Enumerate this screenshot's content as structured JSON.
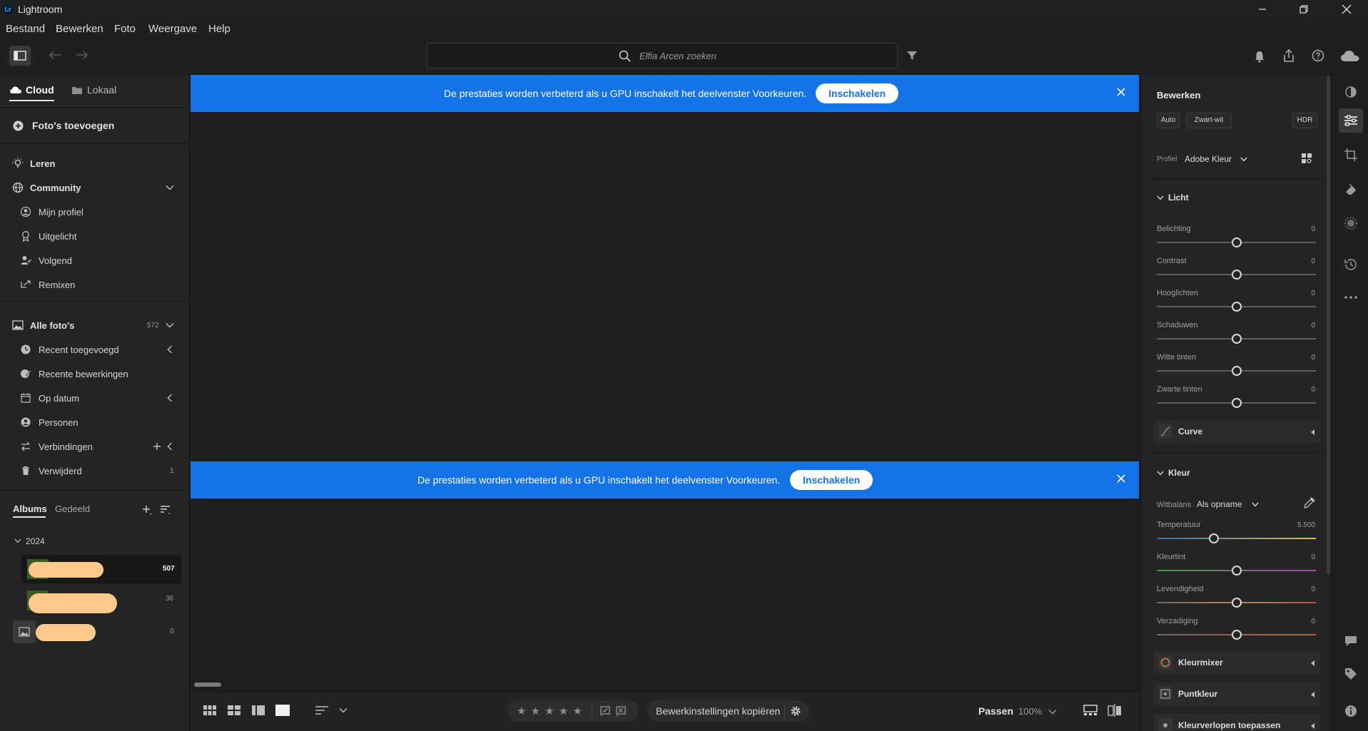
{
  "window": {
    "logo": "Lr",
    "title": "Lightroom"
  },
  "menu": [
    "Bestand",
    "Bewerken",
    "Foto",
    "Weergave",
    "Help"
  ],
  "search": {
    "placeholder": "Elfia Arcen zoeken"
  },
  "left": {
    "tabs": {
      "cloud": "Cloud",
      "local": "Lokaal"
    },
    "add_photos": "Foto's toevoegen",
    "learn": "Leren",
    "community": "Community",
    "community_items": [
      "Mijn profiel",
      "Uitgelicht",
      "Volgend",
      "Remixen"
    ],
    "all_photos": {
      "label": "Alle foto's",
      "count": "572"
    },
    "library_items": [
      {
        "label": "Recent toegevoegd",
        "count": ""
      },
      {
        "label": "Recente bewerkingen",
        "count": ""
      },
      {
        "label": "Op datum",
        "count": ""
      },
      {
        "label": "Personen",
        "count": ""
      },
      {
        "label": "Verbindingen",
        "count": ""
      },
      {
        "label": "Verwijderd",
        "count": "1"
      }
    ],
    "album_tabs": {
      "albums": "Albums",
      "shared": "Gedeeld"
    },
    "year": "2024",
    "albums": [
      {
        "count": "507"
      },
      {
        "count": "36"
      },
      {
        "count": "0"
      }
    ]
  },
  "banners": [
    {
      "text": "De prestaties worden verbeterd als u GPU inschakelt het deelvenster Voorkeuren.",
      "button": "Inschakelen"
    },
    {
      "text": "De prestaties worden verbeterd als u GPU inschakelt het deelvenster Voorkeuren.",
      "button": "Inschakelen"
    }
  ],
  "bottom": {
    "copy_settings": "Bewerkinstellingen kopiëren",
    "fit": "Passen",
    "zoom": "100%",
    "stars": "★ ★ ★ ★ ★"
  },
  "edit": {
    "title": "Bewerken",
    "auto": "Auto",
    "bw": "Zwart-wit",
    "hdr": "HDR",
    "profile_label": "Profiel",
    "profile_value": "Adobe Kleur",
    "light_title": "Licht",
    "light_sliders": [
      {
        "label": "Belichting",
        "value": "0",
        "pos": 0.5
      },
      {
        "label": "Contrast",
        "value": "0",
        "pos": 0.5
      },
      {
        "label": "Hooglichten",
        "value": "0",
        "pos": 0.5
      },
      {
        "label": "Schaduwen",
        "value": "0",
        "pos": 0.5
      },
      {
        "label": "Witte tinten",
        "value": "0",
        "pos": 0.5
      },
      {
        "label": "Zwarte tinten",
        "value": "0",
        "pos": 0.5
      }
    ],
    "curve": "Curve",
    "color_title": "Kleur",
    "wb_label": "Witbalans",
    "wb_value": "Als opname",
    "color_sliders": [
      {
        "label": "Temperatuur",
        "value": "5.500",
        "pos": 0.36
      },
      {
        "label": "Kleurtint",
        "value": "0",
        "pos": 0.5
      },
      {
        "label": "Levendigheid",
        "value": "0",
        "pos": 0.5
      },
      {
        "label": "Verzadiging",
        "value": "0",
        "pos": 0.5
      }
    ],
    "color_mixer": "Kleurmixer",
    "point_color": "Puntkleur",
    "gradients": "Kleurverlopen toepassen"
  },
  "colors": {
    "accent": "#1473e6",
    "panel": "#242424",
    "background": "#1e1e1e"
  }
}
